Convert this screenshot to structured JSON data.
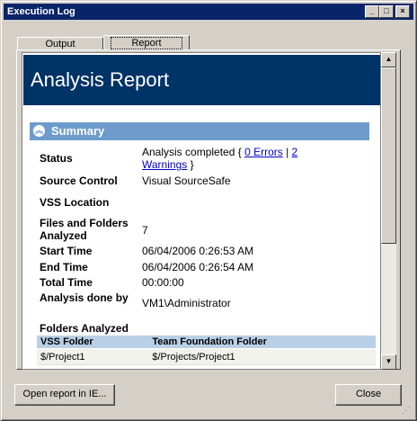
{
  "window": {
    "title": "Execution Log"
  },
  "titlebar_buttons": {
    "minimize": "_",
    "maximize": "□",
    "close": "×"
  },
  "tabs": [
    {
      "label": "Output",
      "active": false
    },
    {
      "label": "Report",
      "active": true
    }
  ],
  "report": {
    "heading": "Analysis Report",
    "summary_section": "Summary",
    "rows": {
      "status": {
        "label": "Status",
        "text_pre": "Analysis completed { ",
        "errors_link": "0 Errors",
        "sep": " | ",
        "warnings_link": "2 Warnings",
        "text_post": " }"
      },
      "source_control": {
        "label": "Source Control",
        "value": "Visual SourceSafe"
      },
      "vss_location": {
        "label": "VSS Location",
        "value": ""
      },
      "files_analyzed": {
        "label": "Files and Folders Analyzed",
        "value": "7"
      },
      "start_time": {
        "label": "Start Time",
        "value": "06/04/2006 0:26:53 AM"
      },
      "end_time": {
        "label": "End Time",
        "value": "06/04/2006 0:26:54 AM"
      },
      "total_time": {
        "label": "Total Time",
        "value": "00:00:00"
      },
      "analysis_by": {
        "label": "Analysis done by",
        "value": "VM1\\Administrator"
      }
    },
    "folders": {
      "title": "Folders Analyzed",
      "columns": [
        "VSS Folder",
        "Team Foundation Folder"
      ],
      "rows": [
        [
          "$/Project1",
          "$/Projects/Project1"
        ]
      ]
    }
  },
  "buttons": {
    "open_ie": "Open report in IE...",
    "close": "Close"
  },
  "colors": {
    "header": "#003366",
    "summary_bar": "#6d9ccc",
    "table_header": "#b9cfe5",
    "link": "#0000cc"
  }
}
